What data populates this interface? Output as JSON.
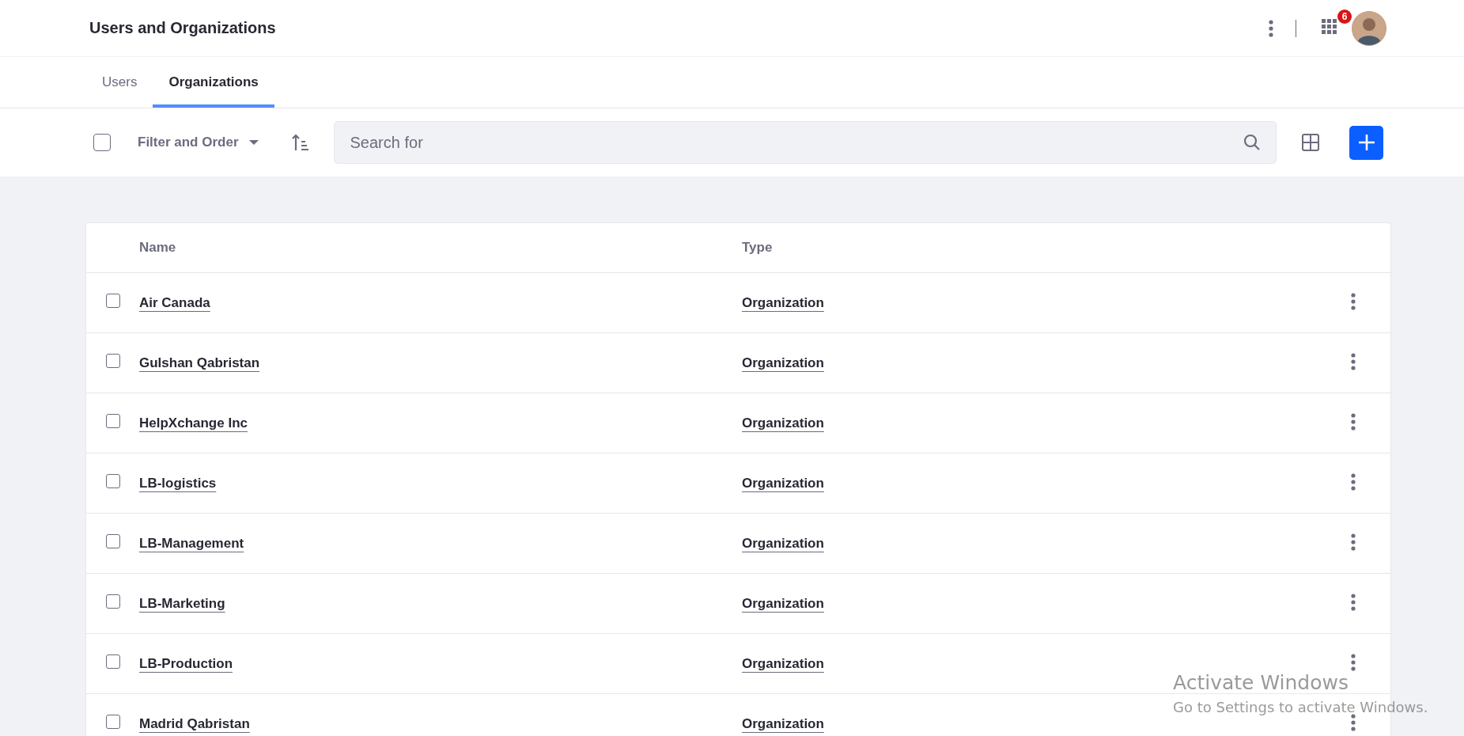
{
  "header": {
    "title": "Users and Organizations",
    "notification_count": "6"
  },
  "tabs": [
    {
      "label": "Users",
      "selected": false
    },
    {
      "label": "Organizations",
      "selected": true
    }
  ],
  "toolbar": {
    "select_all_checked": false,
    "filter_label": "Filter and Order",
    "search": {
      "placeholder": "Search for"
    }
  },
  "table": {
    "columns": [
      "Name",
      "Type"
    ],
    "rows": [
      {
        "name": "Air Canada",
        "type": "Organization",
        "checked": false
      },
      {
        "name": "Gulshan Qabristan",
        "type": "Organization",
        "checked": false
      },
      {
        "name": "HelpXchange Inc",
        "type": "Organization",
        "checked": false
      },
      {
        "name": "LB-logistics",
        "type": "Organization",
        "checked": false
      },
      {
        "name": "LB-Management",
        "type": "Organization",
        "checked": false
      },
      {
        "name": "LB-Marketing",
        "type": "Organization",
        "checked": false
      },
      {
        "name": "LB-Production",
        "type": "Organization",
        "checked": false
      },
      {
        "name": "Madrid Qabristan",
        "type": "Organization",
        "checked": false
      }
    ]
  },
  "os_overlay": {
    "title": "Activate Windows",
    "subtitle": "Go to Settings to activate Windows."
  }
}
